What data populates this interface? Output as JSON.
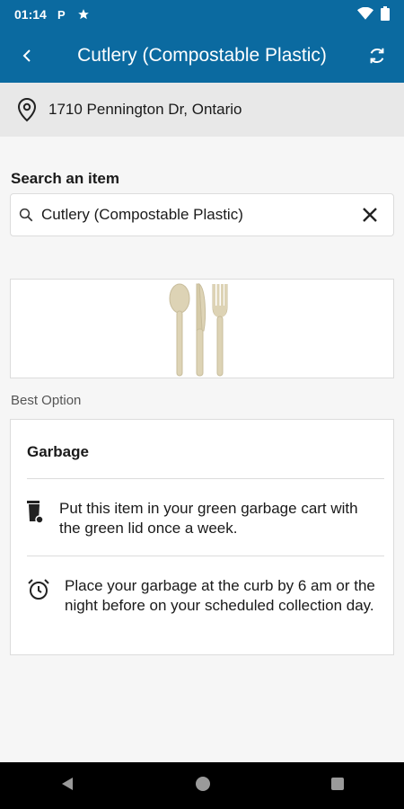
{
  "status_bar": {
    "time": "01:14",
    "icons": [
      "parking-icon",
      "star-icon",
      "wifi-icon",
      "battery-icon"
    ]
  },
  "app_bar": {
    "title": "Cutlery (Compostable Plastic)",
    "back_icon": "chevron-left-icon",
    "refresh_icon": "refresh-icon"
  },
  "address": {
    "icon": "location-pin-icon",
    "text": "1710 Pennington Dr, Ontario"
  },
  "search": {
    "label": "Search an item",
    "value": "Cutlery (Compostable Plastic)",
    "icon": "search-icon",
    "clear_icon": "close-icon"
  },
  "item_image": {
    "name": "cutlery-image"
  },
  "best_option": {
    "label": "Best Option",
    "heading": "Garbage",
    "rows": [
      {
        "icon": "garbage-cart-icon",
        "text": "Put this item in your green garbage cart with the green lid once a week."
      },
      {
        "icon": "alarm-clock-icon",
        "text": "Place your garbage at the curb by 6 am or the night before on your scheduled collection day."
      }
    ]
  },
  "colors": {
    "primary": "#0b6aa0",
    "address_bg": "#e8e8e8",
    "page_bg": "#f6f6f6"
  },
  "nav_bar": {
    "buttons": [
      "back-nav-icon",
      "home-nav-icon",
      "recents-nav-icon"
    ]
  }
}
